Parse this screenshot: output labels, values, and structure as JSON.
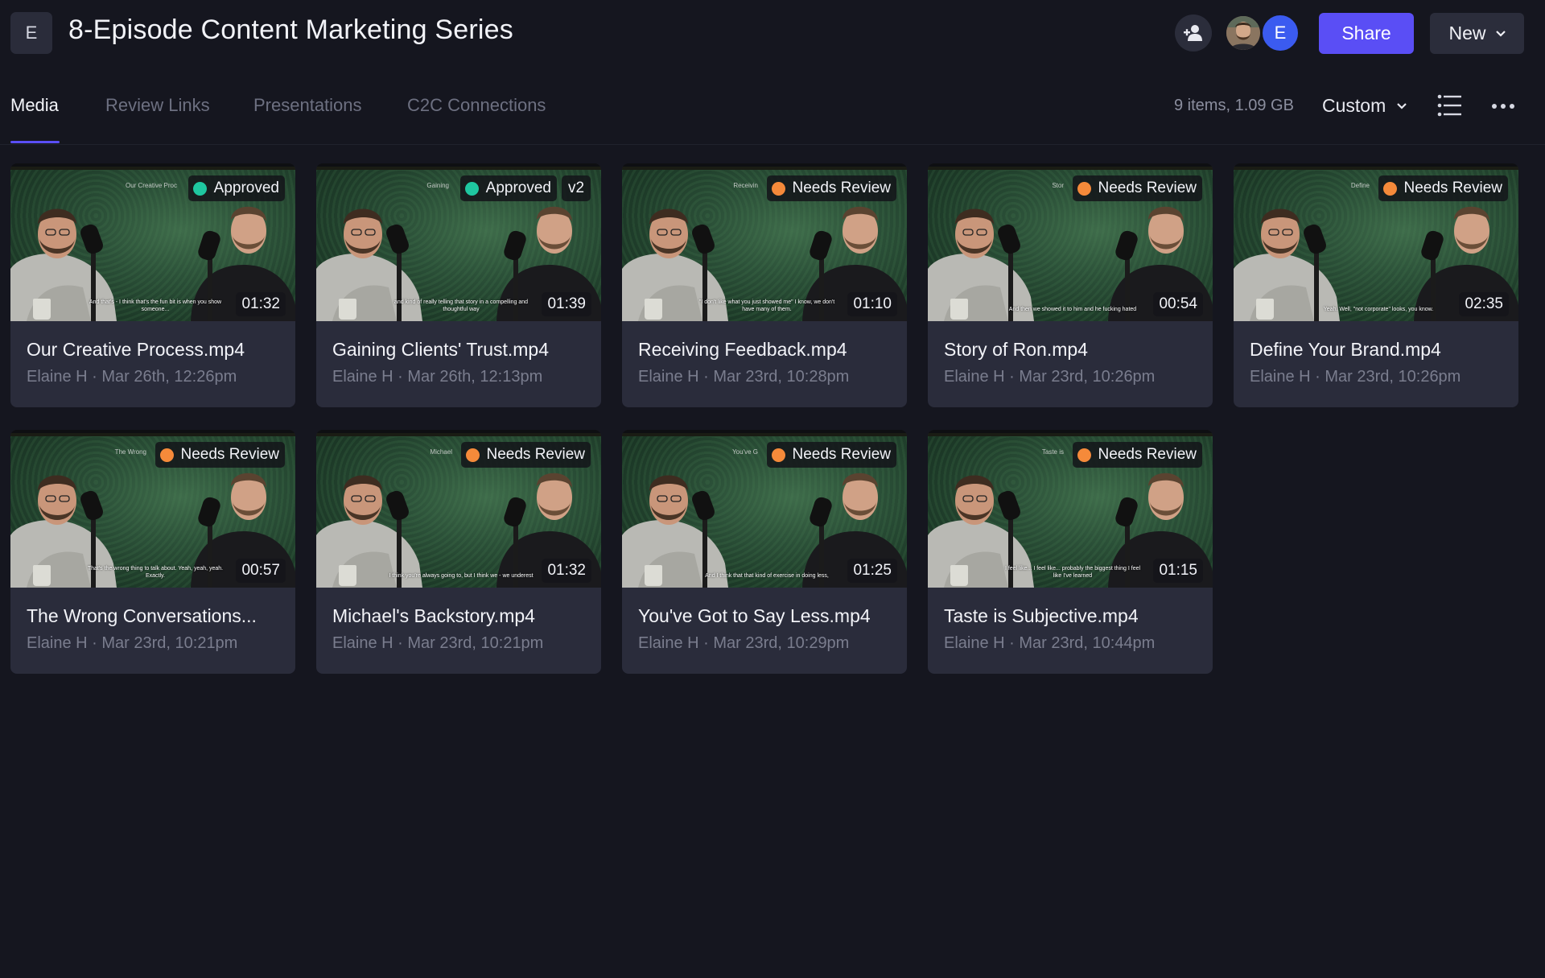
{
  "header": {
    "project_initial": "E",
    "project_title": "8-Episode Content Marketing Series",
    "user_initial": "E",
    "share_label": "Share",
    "new_label": "New"
  },
  "tabs": [
    {
      "label": "Media",
      "active": true
    },
    {
      "label": "Review Links",
      "active": false
    },
    {
      "label": "Presentations",
      "active": false
    },
    {
      "label": "C2C Connections",
      "active": false
    }
  ],
  "toolbar": {
    "item_count": "9 items, 1.09 GB",
    "sort_label": "Custom"
  },
  "colors": {
    "accent": "#5a4ef5",
    "approved": "#1fc7a0",
    "needs_review": "#f58a3a",
    "user_avatar": "#3b5bf0"
  },
  "assets": [
    {
      "status": "Approved",
      "status_color": "#1fc7a0",
      "faded_title": "Our Creative Proc",
      "version": "",
      "duration": "01:32",
      "title": "Our Creative Process.mp4",
      "meta": "Elaine H · Mar 26th, 12:26pm",
      "caption": "And that's - I think that's the fun bit is when you show someone..."
    },
    {
      "status": "Approved",
      "status_color": "#1fc7a0",
      "faded_title": "Gaining",
      "version": "v2",
      "duration": "01:39",
      "title": "Gaining Clients' Trust.mp4",
      "meta": "Elaine H · Mar 26th, 12:13pm",
      "caption": "and kind of really telling that story in a compelling and thoughtful way"
    },
    {
      "status": "Needs Review",
      "status_color": "#f58a3a",
      "faded_title": "Receivin",
      "version": "",
      "duration": "01:10",
      "title": "Receiving Feedback.mp4",
      "meta": "Elaine H · Mar 23rd, 10:28pm",
      "caption": "\"I don't like what you just showed me\" I know, we don't have many of them."
    },
    {
      "status": "Needs Review",
      "status_color": "#f58a3a",
      "faded_title": "Stor",
      "version": "",
      "duration": "00:54",
      "title": "Story of Ron.mp4",
      "meta": "Elaine H · Mar 23rd, 10:26pm",
      "caption": "And then we showed it to him and he fucking hated"
    },
    {
      "status": "Needs Review",
      "status_color": "#f58a3a",
      "faded_title": "Define",
      "version": "",
      "duration": "02:35",
      "title": "Define Your Brand.mp4",
      "meta": "Elaine H · Mar 23rd, 10:26pm",
      "caption": "Yeah. Well, \"not corporate\" looks, you know."
    },
    {
      "status": "Needs Review",
      "status_color": "#f58a3a",
      "faded_title": "The Wrong",
      "version": "",
      "duration": "00:57",
      "title": "The Wrong Conversations...",
      "meta": "Elaine H · Mar 23rd, 10:21pm",
      "caption": "That's the wrong thing to talk about. Yeah, yeah, yeah. Exactly."
    },
    {
      "status": "Needs Review",
      "status_color": "#f58a3a",
      "faded_title": "Michael",
      "version": "",
      "duration": "01:32",
      "title": "Michael's Backstory.mp4",
      "meta": "Elaine H · Mar 23rd, 10:21pm",
      "caption": "I think you're always going to, but I think we - we underest"
    },
    {
      "status": "Needs Review",
      "status_color": "#f58a3a",
      "faded_title": "You've G",
      "version": "",
      "duration": "01:25",
      "title": "You've Got to Say Less.mp4",
      "meta": "Elaine H · Mar 23rd, 10:29pm",
      "caption": "And I think that that kind of exercise in doing less,"
    },
    {
      "status": "Needs Review",
      "status_color": "#f58a3a",
      "faded_title": "Taste is",
      "version": "",
      "duration": "01:15",
      "title": "Taste is Subjective.mp4",
      "meta": "Elaine H · Mar 23rd, 10:44pm",
      "caption": "I feel like... I feel like... probably the biggest thing I feel like I've learned"
    }
  ]
}
